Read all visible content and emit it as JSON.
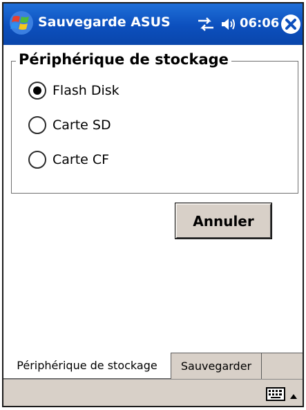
{
  "titlebar": {
    "app_title": "Sauvegarde ASUS",
    "clock": "06:06",
    "start_icon": "windows-flag-icon",
    "connectivity_icon": "connectivity-arrows-icon",
    "volume_icon": "speaker-icon",
    "close_icon": "close-icon"
  },
  "storage": {
    "group_title": "Périphérique de stockage",
    "options": [
      {
        "label": "Flash Disk",
        "checked": true
      },
      {
        "label": "Carte SD",
        "checked": false
      },
      {
        "label": "Carte CF",
        "checked": false
      }
    ]
  },
  "actions": {
    "cancel_label": "Annuler"
  },
  "tabs": [
    {
      "label": "Périphérique de stockage",
      "active": true
    },
    {
      "label": "Sauvegarder",
      "active": false
    }
  ],
  "menubar": {
    "keyboard_icon": "keyboard-icon",
    "arrow_icon": "arrow-up-icon"
  },
  "colors": {
    "titlebar": "#0c4fbd",
    "chrome": "#d8d0c8"
  }
}
